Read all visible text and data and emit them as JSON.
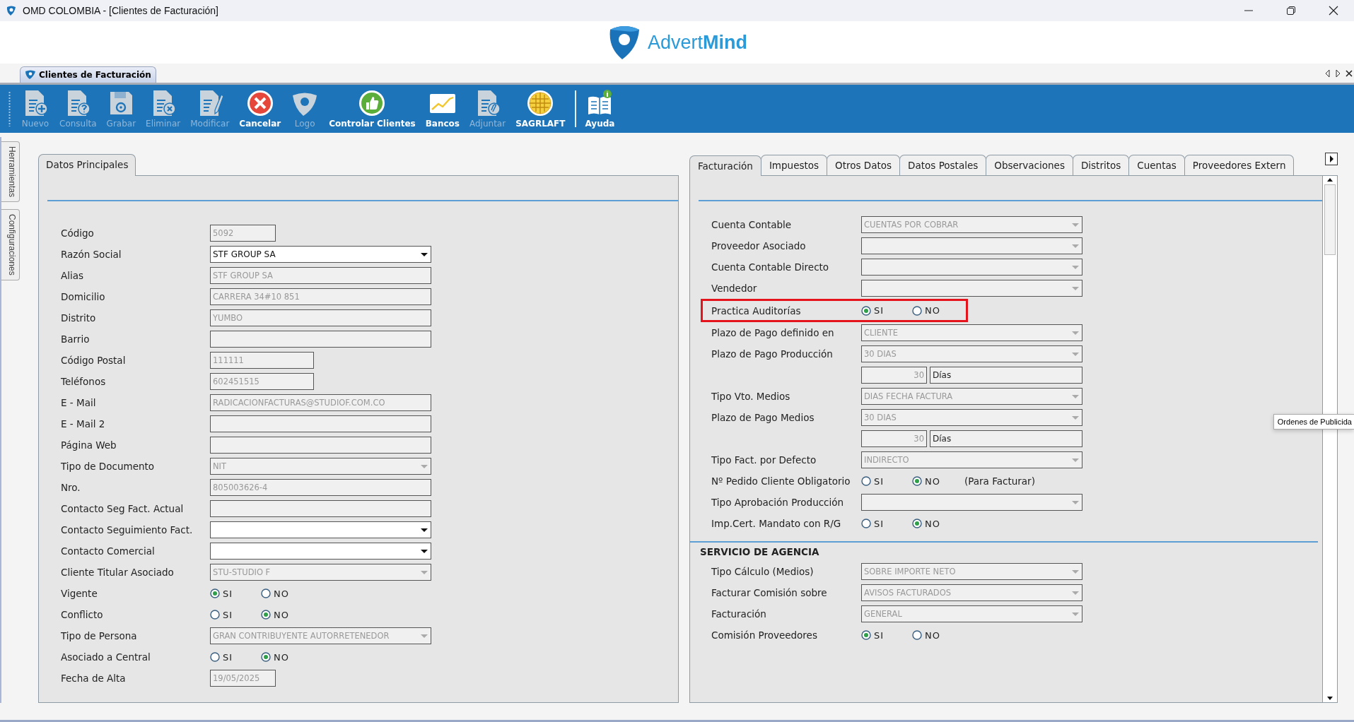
{
  "window": {
    "title": "OMD COLOMBIA - [Clientes de Facturación]"
  },
  "brand": {
    "name": "Advert**Mind**"
  },
  "document_tab": {
    "label": "Clientes de Facturación"
  },
  "toolbar": [
    {
      "label": "Nuevo",
      "kind": "new",
      "disabled": true
    },
    {
      "label": "Consulta",
      "kind": "query",
      "disabled": true
    },
    {
      "label": "Grabar",
      "kind": "save",
      "disabled": true
    },
    {
      "label": "Eliminar",
      "kind": "delete",
      "disabled": true
    },
    {
      "label": "Modificar",
      "kind": "edit",
      "disabled": true
    },
    {
      "label": "Cancelar",
      "kind": "cancel",
      "disabled": false
    },
    {
      "label": "Logo",
      "kind": "logo",
      "disabled": true
    },
    {
      "label": "Controlar Clientes",
      "kind": "approve",
      "disabled": false
    },
    {
      "label": "Bancos",
      "kind": "chart",
      "disabled": false
    },
    {
      "label": "Adjuntar",
      "kind": "attach",
      "disabled": true
    },
    {
      "label": "SAGRLAFT",
      "kind": "grid",
      "disabled": false
    },
    {
      "label": "Ayuda",
      "kind": "help",
      "disabled": false
    }
  ],
  "side_tabs": [
    "Herramientas",
    "Configuraciones"
  ],
  "left_panel": {
    "tab": "Datos Principales",
    "rows": [
      {
        "label": "Código",
        "kind": "short-text",
        "value": "5092"
      },
      {
        "label": "Razón Social",
        "kind": "combo",
        "value": "STF GROUP SA",
        "disabled": false
      },
      {
        "label": "Alias",
        "kind": "text",
        "value": "STF GROUP SA"
      },
      {
        "label": "Domicilio",
        "kind": "text",
        "value": "CARRERA 34#10 851"
      },
      {
        "label": "Distrito",
        "kind": "text",
        "value": "YUMBO"
      },
      {
        "label": "Barrio",
        "kind": "text"
      },
      {
        "label": "Código Postal",
        "kind": "mid-text",
        "value": "111111"
      },
      {
        "label": "Teléfonos",
        "kind": "mid-text",
        "value": "602451515"
      },
      {
        "label": "E - Mail",
        "kind": "text",
        "value": "RADICACIONFACTURAS@STUDIOF.COM.CO"
      },
      {
        "label": "E - Mail 2",
        "kind": "text"
      },
      {
        "label": "Página Web",
        "kind": "text"
      },
      {
        "label": "Tipo de Documento",
        "kind": "combo",
        "value": "NIT",
        "disabled": true
      },
      {
        "label": "Nro.",
        "kind": "text",
        "value": "805003626-4"
      },
      {
        "label": "Contacto Seg Fact. Actual",
        "kind": "text"
      },
      {
        "label": "Contacto Seguimiento Fact.",
        "kind": "combo",
        "disabled": false
      },
      {
        "label": "Contacto Comercial",
        "kind": "combo",
        "disabled": false
      },
      {
        "label": "Cliente Titular Asociado",
        "kind": "combo",
        "value": "STU-STUDIO F",
        "disabled": true
      },
      {
        "label": "Vigente",
        "kind": "radio",
        "options": [
          {
            "label": "SI",
            "selected": true
          },
          {
            "label": "NO",
            "selected": false
          }
        ]
      },
      {
        "label": "Conflicto",
        "kind": "radio",
        "options": [
          {
            "label": "SI",
            "selected": false
          },
          {
            "label": "NO",
            "selected": true
          }
        ]
      },
      {
        "label": "Tipo de Persona",
        "kind": "combo",
        "value": "GRAN CONTRIBUYENTE AUTORRETENEDOR",
        "disabled": true
      },
      {
        "label": "Asociado a Central",
        "kind": "radio",
        "options": [
          {
            "label": "SI",
            "selected": false
          },
          {
            "label": "NO",
            "selected": true
          }
        ]
      },
      {
        "label": "Fecha de Alta",
        "kind": "short-text",
        "value": "19/05/2025"
      }
    ]
  },
  "right_panel": {
    "tabs": [
      {
        "label": "Facturación",
        "selected": true
      },
      {
        "label": "Impuestos",
        "selected": false
      },
      {
        "label": "Otros Datos",
        "selected": false
      },
      {
        "label": "Datos Postales",
        "selected": false
      },
      {
        "label": "Observaciones",
        "selected": false
      },
      {
        "label": "Distritos",
        "selected": false
      },
      {
        "label": "Cuentas",
        "selected": false
      },
      {
        "label": "Proveedores Extern",
        "selected": false
      }
    ],
    "rows": [
      {
        "label": "Cuenta Contable",
        "kind": "combo",
        "value": "CUENTAS POR COBRAR",
        "disabled": true,
        "highlighted": false
      },
      {
        "label": "Proveedor Asociado",
        "kind": "combo",
        "disabled": true,
        "highlighted": false
      },
      {
        "label": "Cuenta Contable Directo",
        "kind": "combo",
        "disabled": true,
        "highlighted": false
      },
      {
        "label": "Vendedor",
        "kind": "combo",
        "disabled": true,
        "highlighted": false
      },
      {
        "label": "Practica Auditorías",
        "kind": "radio",
        "highlighted": true,
        "options": [
          {
            "label": "SI",
            "selected": true
          },
          {
            "label": "NO",
            "selected": false
          }
        ]
      },
      {
        "label": "Plazo de Pago definido en",
        "kind": "combo",
        "value": "CLIENTE",
        "disabled": true,
        "highlighted": false
      },
      {
        "label": "Plazo de Pago Producción",
        "kind": "combo",
        "value": "30 DIAS",
        "disabled": true,
        "highlighted": false
      },
      {
        "kind": "number-unit",
        "number": "30",
        "unit": "Días",
        "highlighted": false
      },
      {
        "label": "Tipo Vto. Medios",
        "kind": "combo",
        "value": "DIAS FECHA FACTURA",
        "disabled": true,
        "highlighted": false
      },
      {
        "label": "Plazo de Pago Medios",
        "kind": "combo",
        "value": "30 DIAS",
        "disabled": true,
        "highlighted": false
      },
      {
        "kind": "number-unit",
        "number": "30",
        "unit": "Días",
        "highlighted": false
      },
      {
        "label": "Tipo Fact. por Defecto",
        "kind": "combo",
        "value": "INDIRECTO",
        "disabled": true,
        "highlighted": false
      },
      {
        "label": "Nº Pedido Cliente Obligatorio",
        "kind": "radio",
        "note": "(Para Facturar)",
        "highlighted": false,
        "options": [
          {
            "label": "SI",
            "selected": false
          },
          {
            "label": "NO",
            "selected": true
          }
        ]
      },
      {
        "label": "Tipo Aprobación Producción",
        "kind": "combo",
        "disabled": true,
        "highlighted": false
      },
      {
        "label": "Imp.Cert. Mandato con R/G",
        "kind": "radio",
        "highlighted": false,
        "options": [
          {
            "label": "SI",
            "selected": false
          },
          {
            "label": "NO",
            "selected": true
          }
        ]
      }
    ],
    "section": {
      "title": "SERVICIO DE AGENCIA",
      "rows": [
        {
          "label": "Tipo Cálculo (Medios)",
          "kind": "combo",
          "value": "SOBRE IMPORTE NETO",
          "disabled": true,
          "highlighted": false
        },
        {
          "label": "Facturar Comisión sobre",
          "kind": "combo",
          "value": "AVISOS FACTURADOS",
          "disabled": true,
          "highlighted": false
        },
        {
          "label": "Facturación",
          "kind": "combo",
          "value": "GENERAL",
          "disabled": true,
          "highlighted": false
        },
        {
          "label": "Comisión Proveedores",
          "kind": "radio",
          "highlighted": false,
          "options": [
            {
              "label": "SI",
              "selected": true
            },
            {
              "label": "NO",
              "selected": false
            }
          ]
        }
      ]
    }
  },
  "tooltip": {
    "text": "Ordenes de Publicida"
  }
}
